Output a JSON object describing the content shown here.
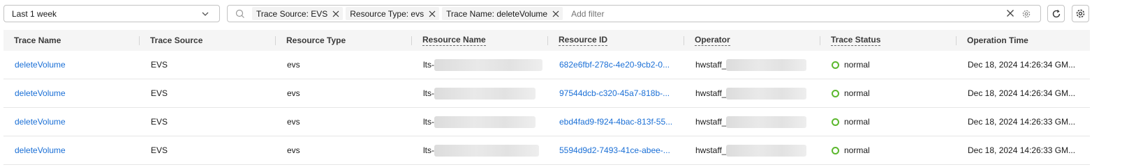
{
  "toolbar": {
    "time_range": "Last 1 week",
    "filters": [
      {
        "label": "Trace Source: EVS"
      },
      {
        "label": "Resource Type: evs"
      },
      {
        "label": "Trace Name: deleteVolume"
      }
    ],
    "add_filter_placeholder": "Add filter"
  },
  "table": {
    "columns": [
      "Trace Name",
      "Trace Source",
      "Resource Type",
      "Resource Name",
      "Resource ID",
      "Operator",
      "Trace Status",
      "Operation Time"
    ],
    "rows": [
      {
        "trace_name": "deleteVolume",
        "trace_source": "EVS",
        "resource_type": "evs",
        "resource_name_prefix": "lts-",
        "resource_id": "682e6fbf-278c-4e20-9cb2-0...",
        "operator_prefix": "hwstaff_",
        "status": "normal",
        "operation_time": "Dec 18, 2024 14:26:34 GM..."
      },
      {
        "trace_name": "deleteVolume",
        "trace_source": "EVS",
        "resource_type": "evs",
        "resource_name_prefix": "lts-",
        "resource_id": "97544dcb-c320-45a7-818b-...",
        "operator_prefix": "hwstaff_",
        "status": "normal",
        "operation_time": "Dec 18, 2024 14:26:34 GM..."
      },
      {
        "trace_name": "deleteVolume",
        "trace_source": "EVS",
        "resource_type": "evs",
        "resource_name_prefix": "lts-",
        "resource_id": "ebd4fad9-f924-4bac-813f-55...",
        "operator_prefix": "hwstaff_",
        "status": "normal",
        "operation_time": "Dec 18, 2024 14:26:33 GM..."
      },
      {
        "trace_name": "deleteVolume",
        "trace_source": "EVS",
        "resource_type": "evs",
        "resource_name_prefix": "lts-",
        "resource_id": "5594d9d2-7493-41ce-abee-...",
        "operator_prefix": "hwstaff_",
        "status": "normal",
        "operation_time": "Dec 18, 2024 14:26:33 GM..."
      }
    ]
  },
  "colors": {
    "link": "#1a6fd6",
    "status_normal": "#5cb82e",
    "header_bg": "#f5f5f5"
  },
  "icons": [
    "chevron-down-icon",
    "search-icon",
    "close-icon",
    "gear-icon",
    "refresh-icon"
  ]
}
